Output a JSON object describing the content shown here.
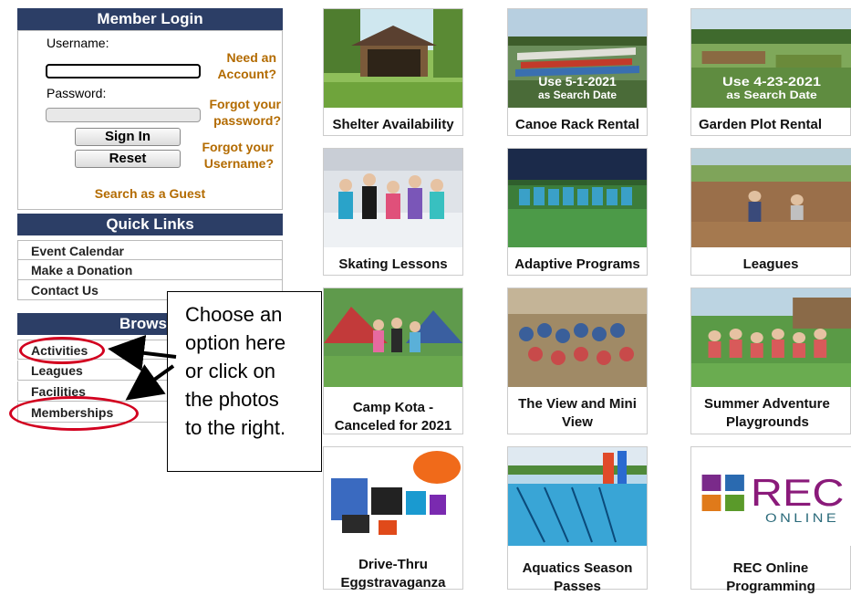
{
  "login": {
    "title": "Member Login",
    "username_label": "Username:",
    "password_label": "Password:",
    "need_account_1": "Need an",
    "need_account_2": "Account?",
    "forgot_password_1": "Forgot your",
    "forgot_password_2": "password?",
    "forgot_username_1": "Forgot your",
    "forgot_username_2": "Username?",
    "sign_in": "Sign In",
    "reset": "Reset",
    "guest": "Search as a Guest"
  },
  "quick_links": {
    "title": "Quick Links",
    "items": [
      "Event Calendar",
      "Make a Donation",
      "Contact Us"
    ]
  },
  "browse": {
    "title": "Brows",
    "items": [
      "Activities",
      "Leagues",
      "Facilities",
      "Memberships"
    ]
  },
  "callout": {
    "lines": [
      "Choose an",
      "option here",
      "or click on",
      "the photos",
      "to the right."
    ]
  },
  "tiles": [
    {
      "caption": "Shelter Availability",
      "overlay": ""
    },
    {
      "caption": "Canoe Rack Rental",
      "overlay_1": "Use 5-1-2021",
      "overlay_2": "as Search Date"
    },
    {
      "caption": "Garden Plot Rental",
      "overlay_1": "Use 4-23-2021",
      "overlay_2": "as Search Date"
    },
    {
      "caption": "Skating Lessons"
    },
    {
      "caption": "Adaptive Programs"
    },
    {
      "caption": "Leagues"
    },
    {
      "caption_1": "Camp Kota -",
      "caption_2": "Canceled for 2021"
    },
    {
      "caption_1": "The View and Mini",
      "caption_2": "View"
    },
    {
      "caption_1": "Summer Adventure",
      "caption_2": "Playgrounds"
    },
    {
      "caption_1": "Drive-Thru",
      "caption_2": "Eggstravaganza"
    },
    {
      "caption_1": "Aquatics Season",
      "caption_2": "Passes"
    },
    {
      "caption_1": "REC Online",
      "caption_2": "Programming",
      "logo_text": "REC",
      "logo_sub": "ONLINE"
    }
  ],
  "colors": {
    "header_bg": "#2c3e66",
    "link_orange": "#b36b00",
    "highlight_red": "#d2001f"
  }
}
